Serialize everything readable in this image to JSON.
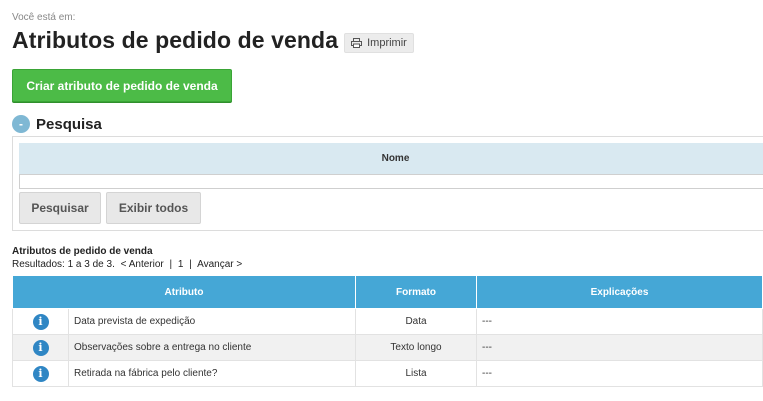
{
  "breadcrumb": "Você está em:",
  "page_title": "Atributos de pedido de venda",
  "print_label": "Imprimir",
  "create_button": "Criar atributo de pedido de venda",
  "search": {
    "toggle_symbol": "-",
    "title": "Pesquisa",
    "column_header": "Nome",
    "name_value": "",
    "search_button": "Pesquisar",
    "show_all_button": "Exibir todos"
  },
  "results": {
    "title": "Atributos de pedido de venda",
    "summary": "Resultados: 1 a 3 de 3.",
    "prev_link": "< Anterior",
    "sep1": "|",
    "page_number": "1",
    "sep2": "|",
    "next_link": "Avançar >",
    "columns": [
      "Atributo",
      "Formato",
      "Explicações"
    ],
    "rows": [
      {
        "icon": "info-icon",
        "attribute": "Data prevista de expedição",
        "format": "Data",
        "explanation": "---"
      },
      {
        "icon": "info-icon",
        "attribute": "Observações sobre a entrega no cliente",
        "format": "Texto longo",
        "explanation": "---"
      },
      {
        "icon": "info-icon",
        "attribute": "Retirada na fábrica pelo cliente?",
        "format": "Lista",
        "explanation": "---"
      }
    ]
  },
  "colors": {
    "create_button": "#4cbb47",
    "table_header": "#45a7d6",
    "info_icon": "#2f86c4",
    "search_header": "#d9e9f1"
  }
}
